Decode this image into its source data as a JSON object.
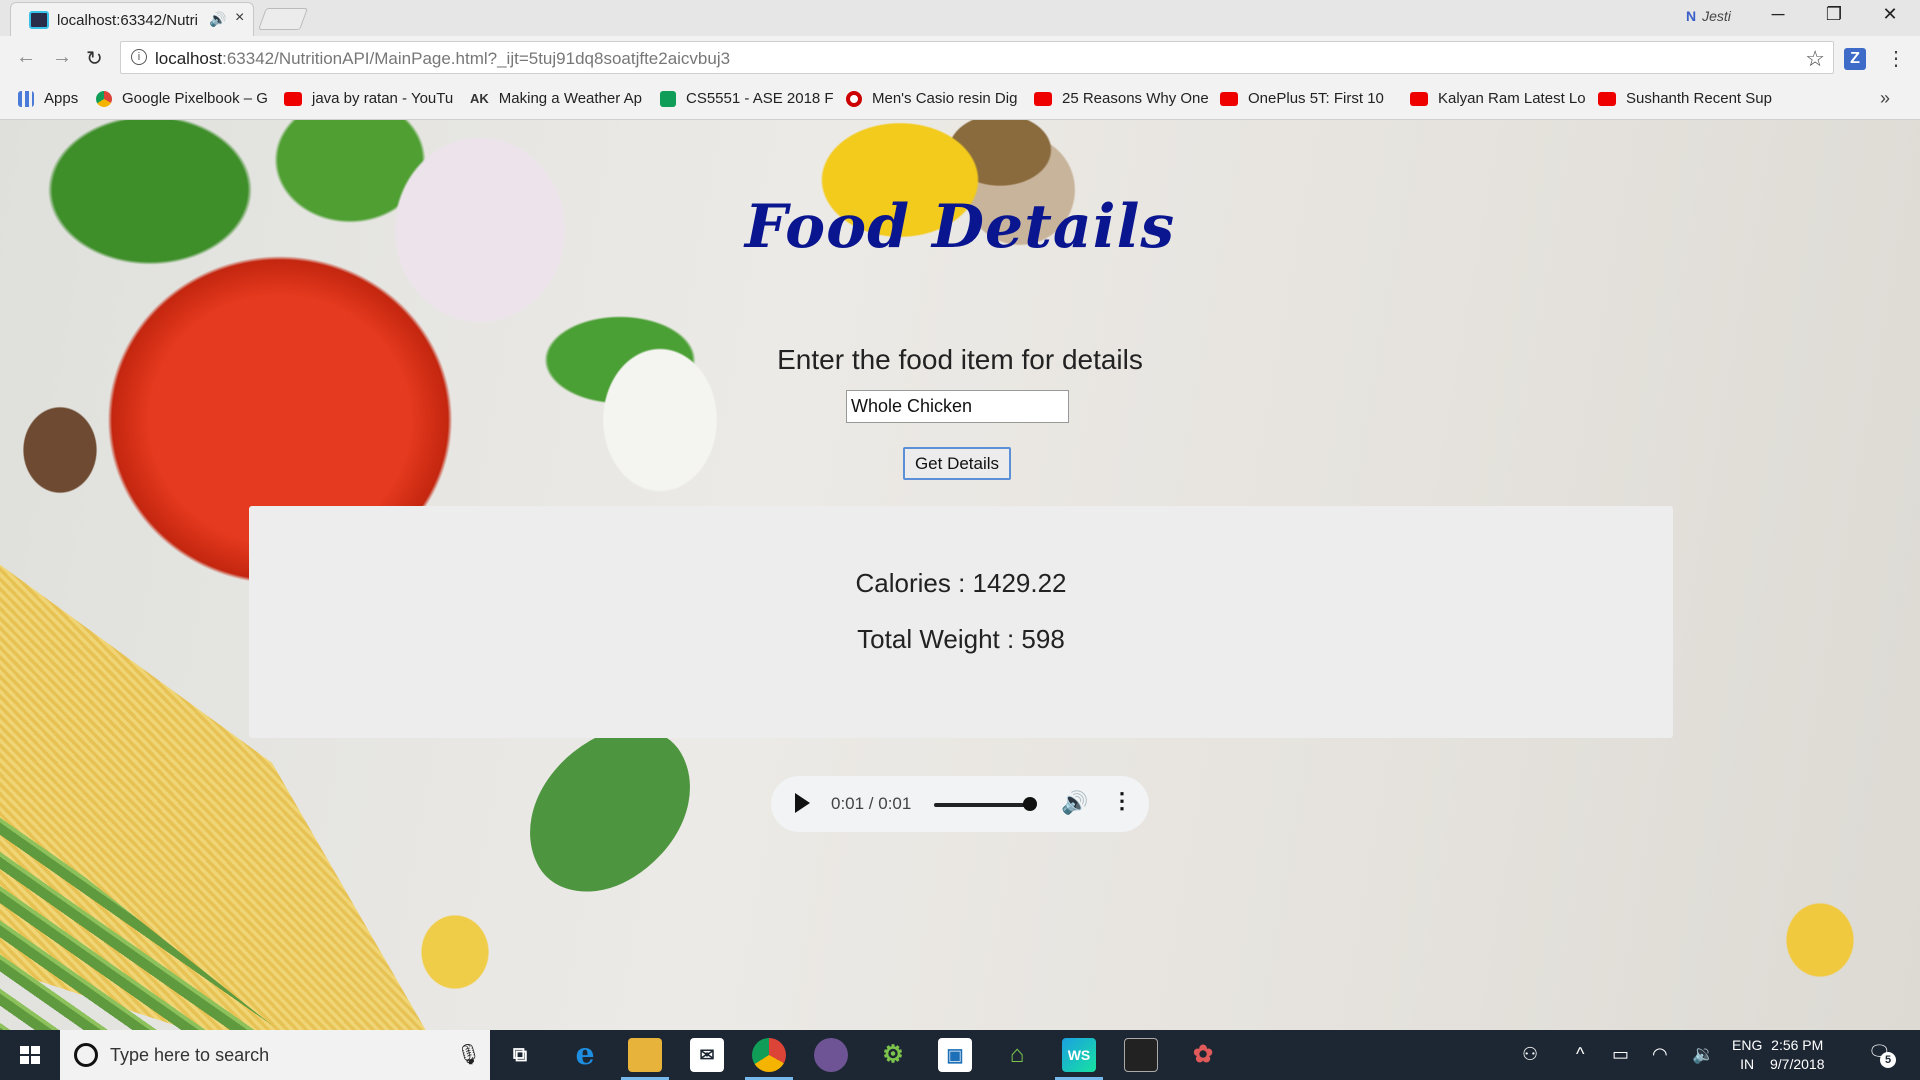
{
  "browser": {
    "tab_title": "localhost:63342/Nutri",
    "tab_audio_icon": "speaker-icon",
    "tab_close": "×",
    "profile_name": "Jesti",
    "window_controls": {
      "minimize": "─",
      "maximize": "❐",
      "close": "✕"
    },
    "url_host": "localhost",
    "url_rest": ":63342/NutritionAPI/MainPage.html?_ijt=5tuj91dq8soatjfte2aicvbuj3",
    "ext_label": "Z",
    "bookmarks": [
      {
        "label": "Apps",
        "icon": "apps"
      },
      {
        "label": "Google Pixelbook – G",
        "icon": "chrome"
      },
      {
        "label": "java by ratan - YouTu",
        "icon": "yt"
      },
      {
        "label": "Making a Weather Ap",
        "icon": "ak"
      },
      {
        "label": "CS5551 - ASE 2018 F",
        "icon": "sheet"
      },
      {
        "label": "Men's Casio resin Dig",
        "icon": "target"
      },
      {
        "label": "25 Reasons Why One",
        "icon": "yt"
      },
      {
        "label": "OnePlus 5T: First 10",
        "icon": "yt"
      },
      {
        "label": "Kalyan Ram Latest Lo",
        "icon": "yt"
      },
      {
        "label": "Sushanth Recent Sup",
        "icon": "yt"
      }
    ],
    "bookmarks_more": "»"
  },
  "page": {
    "heading": "Food Details",
    "prompt": "Enter the food item for details",
    "food_input_value": "Whole Chicken",
    "button_label": "Get Details",
    "calories_line": "Calories : 1429.22",
    "weight_line": "Total Weight : 598",
    "audio": {
      "time": "0:01 / 0:01",
      "progress": 1.0
    }
  },
  "taskbar": {
    "search_placeholder": "Type here to search",
    "lang_top": "ENG",
    "lang_bottom": "IN",
    "time": "2:56 PM",
    "date": "9/7/2018",
    "notification_count": "5",
    "pinned": [
      "task-view",
      "edge",
      "file-explorer",
      "mail",
      "chrome",
      "github-desktop",
      "android-studio",
      "intellij",
      "android-device",
      "webstorm",
      "terminal",
      "paint"
    ]
  },
  "colors": {
    "heading": "#0a1690",
    "accent_button_border": "#5b8fd8",
    "taskbar": "#1d2733"
  }
}
